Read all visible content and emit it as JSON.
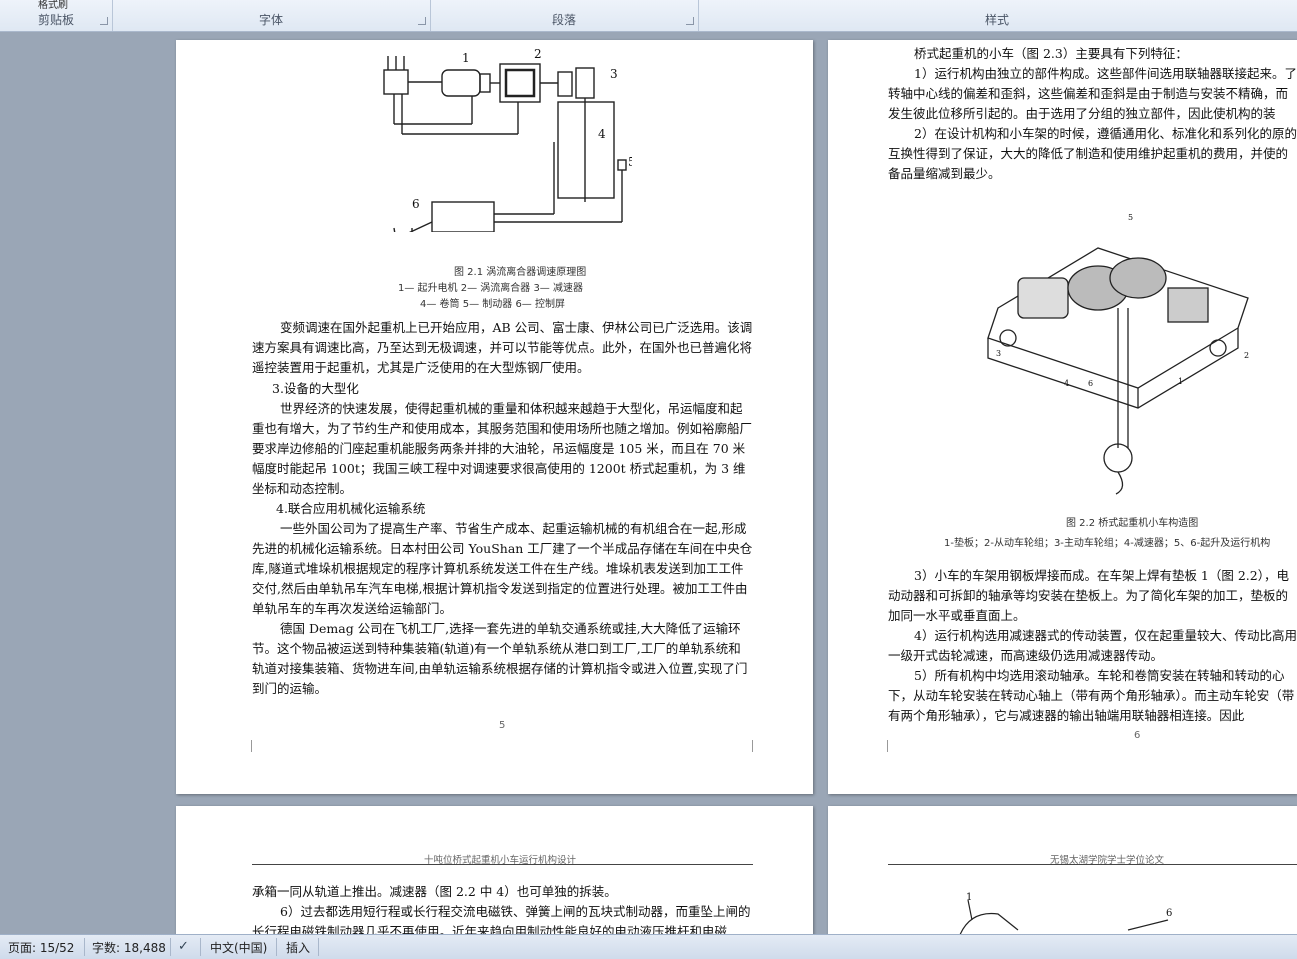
{
  "ribbon": {
    "groups": [
      "剪贴板",
      "字体",
      "段落",
      "样式"
    ],
    "top_fragment": "格式刷"
  },
  "page5": {
    "figure_caption": "图 2.1    涡流离合器调速原理图",
    "figure_legend_1": "1— 起升电机    2— 涡流离合器       3— 减速器",
    "figure_legend_2": "4— 卷筒    5— 制动器     6— 控制屏",
    "fig_labels": [
      "1",
      "2",
      "3",
      "4",
      "5",
      "6"
    ],
    "paragraphs": [
      "变频调速在国外起重机上已开始应用，AB 公司、富士康、伊林公司已广泛选用。该调速方案具有调速比高，乃至达到无极调速，并可以节能等优点。此外，在国外也已普遍化将遥控装置用于起重机，尤其是广泛使用的在大型炼钢厂使用。",
      "3.设备的大型化",
      "世界经济的快速发展，使得起重机械的重量和体积越来越趋于大型化，吊运幅度和起重也有增大，为了节约生产和使用成本，其服务范围和使用场所也随之增加。例如裕廓船厂要求岸边修船的门座起重机能服务两条并排的大油轮，吊运幅度是 105 米，而且在 70 米幅度时能起吊 100t；我国三峡工程中对调速要求很高使用的 1200t 桥式起重机，为 3 维坐标和动态控制。",
      "4.联合应用机械化运输系统",
      "一些外国公司为了提高生产率、节省生产成本、起重运输机械的有机组合在一起,形成先进的机械化运输系统。日本村田公司 YouShan 工厂建了一个半成品存储在车间在中央仓库,隧道式堆垛机根据规定的程序计算机系统发送工件在生产线。堆垛机表发送到加工工件交付,然后由单轨吊车汽车电梯,根据计算机指令发送到指定的位置进行处理。被加工工件由单轨吊车的车再次发送给运输部门。",
      "德国  Demag 公司在飞机工厂,选择一套先进的单轨交通系统或挂,大大降低了运输环节。这个物品被运送到特种集装箱(轨道)有一个单轨系统从港口到工厂,工厂的单轨系统和轨道对接集装箱、货物进车间,由单轨运输系统根据存储的计算机指令或进入位置,实现了门到门的运输。"
    ],
    "page_number": "5"
  },
  "page6": {
    "paragraphs": [
      "桥式起重机的小车（图 2.3）主要具有下列特征：",
      "1）运行机构由独立的部件构成。这些部件间选用联轴器联接起来。了转轴中心线的偏差和歪斜，这些偏差和歪斜是由于制造与安装不精确，而发生彼此位移所引起的。由于选用了分组的独立部件，因此使机构的装",
      "2）在设计机构和小车架的时候，遵循通用化、标准化和系列化的原的互换性得到了保证，大大的降低了制造和使用维护起重机的费用，并使的备品量缩减到最少。"
    ],
    "figure_caption": "图 2.2  桥式起重机小车构造图",
    "figure_legend": "1-垫板；2-从动车轮组；3-主动车轮组；4-减速器；5、6-起升及运行机构",
    "fig_labels": [
      "1",
      "2",
      "3",
      "4",
      "5",
      "6"
    ],
    "paragraphs_after": [
      "3）小车的车架用钢板焊接而成。在车架上焊有垫板 1（图 2.2），电动动器和可拆卸的轴承等均安装在垫板上。为了简化车架的加工，垫板的加同一水平或垂直面上。",
      "4）运行机构选用减速器式的传动装置，仅在起重量较大、传动比高用一级开式齿轮减速，而高速级仍选用减速器传动。",
      "5）所有机构中均选用滚动轴承。车轮和卷筒安装在转轴和转动的心下，从动车轮安装在转动心轴上（带有两个角形轴承）。而主动车轮安（带有两个角形轴承），它与减速器的输出轴端用联轴器相连接。因此"
    ],
    "page_number": "6"
  },
  "page7": {
    "header": "十吨位桥式起重机小车运行机构设计",
    "paragraphs": [
      "承箱一同从轨道上推出。减速器（图 2.2 中 4）也可单独的拆装。",
      "6）过去都选用短行程或长行程交流电磁铁、弹簧上闸的瓦块式制动器，而重坠上闸的长行程电磁铁制动器几乎不再使用。近年来趋向用制动性能良好的电动液压推杆和电磁"
    ]
  },
  "page8": {
    "header": "无锡太湖学院学士学位论文",
    "fig_labels": [
      "1",
      "6"
    ]
  },
  "status": {
    "page": "页面: 15/52",
    "words": "字数: 18,488",
    "language": "中文(中国)",
    "mode": "插入"
  }
}
